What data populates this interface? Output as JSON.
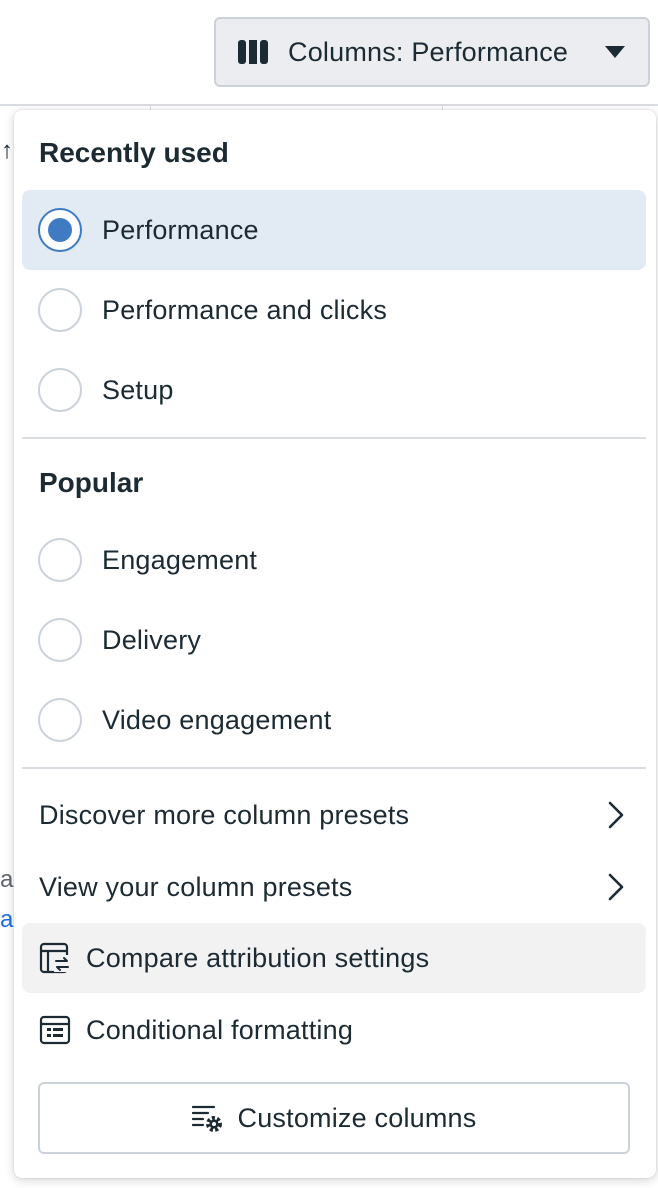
{
  "toolbar": {
    "columns_button_label": "Columns: Performance",
    "columns_icon": "columns-icon",
    "caret_icon": "caret-down-icon"
  },
  "background": {
    "arrow_glyph": "↑",
    "frag_a": "a",
    "frag_link": "a"
  },
  "menu": {
    "recently_used": {
      "title": "Recently used",
      "options": [
        {
          "label": "Performance",
          "selected": true
        },
        {
          "label": "Performance and clicks",
          "selected": false
        },
        {
          "label": "Setup",
          "selected": false
        }
      ]
    },
    "popular": {
      "title": "Popular",
      "options": [
        {
          "label": "Engagement",
          "selected": false
        },
        {
          "label": "Delivery",
          "selected": false
        },
        {
          "label": "Video engagement",
          "selected": false
        }
      ]
    },
    "links": [
      {
        "label": "Discover more column presets",
        "icon": "chevron-right-icon"
      },
      {
        "label": "View your column presets",
        "icon": "chevron-right-icon"
      }
    ],
    "actions": [
      {
        "label": "Compare attribution settings",
        "icon": "compare-attribution-icon"
      },
      {
        "label": "Conditional formatting",
        "icon": "conditional-formatting-icon"
      }
    ],
    "customize_button": {
      "label": "Customize columns",
      "icon": "customize-columns-icon"
    }
  },
  "colors": {
    "accent": "#3e7bc3",
    "selected_bg": "#e2ebf4",
    "text": "#1c2b33",
    "link": "#216fdb"
  }
}
